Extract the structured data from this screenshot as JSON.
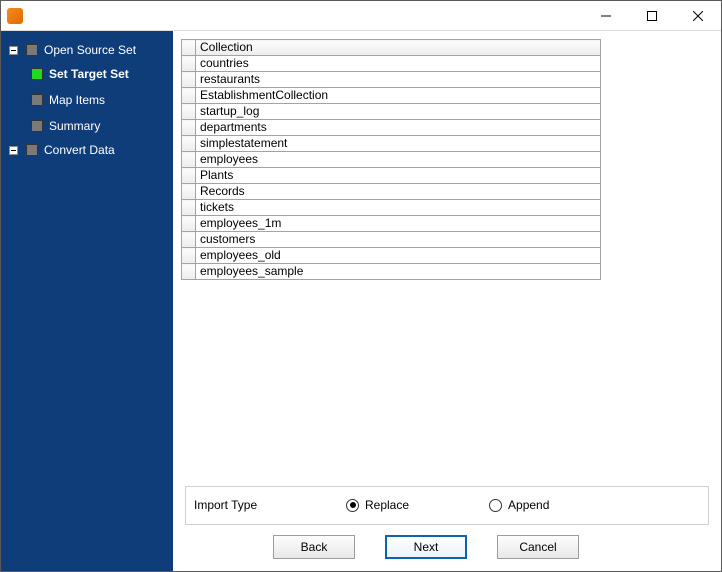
{
  "titlebar": {
    "title": ""
  },
  "sidebar": {
    "root": {
      "label": "Open Source Set",
      "children": [
        {
          "id": "set-target",
          "label": "Set Target Set",
          "active": true
        },
        {
          "id": "map-items",
          "label": "Map Items",
          "active": false
        },
        {
          "id": "summary",
          "label": "Summary",
          "active": false
        }
      ]
    },
    "convert": {
      "label": "Convert Data"
    }
  },
  "table": {
    "header": "Collection",
    "rows": [
      "countries",
      "restaurants",
      "EstablishmentCollection",
      "startup_log",
      "departments",
      "simplestatement",
      "employees",
      "Plants",
      "Records",
      "tickets",
      "employees_1m",
      "customers",
      "employees_old",
      "employees_sample"
    ]
  },
  "import": {
    "label": "Import Type",
    "options": {
      "replace": "Replace",
      "append": "Append"
    },
    "selected": "replace"
  },
  "buttons": {
    "back": "Back",
    "next": "Next",
    "cancel": "Cancel"
  }
}
